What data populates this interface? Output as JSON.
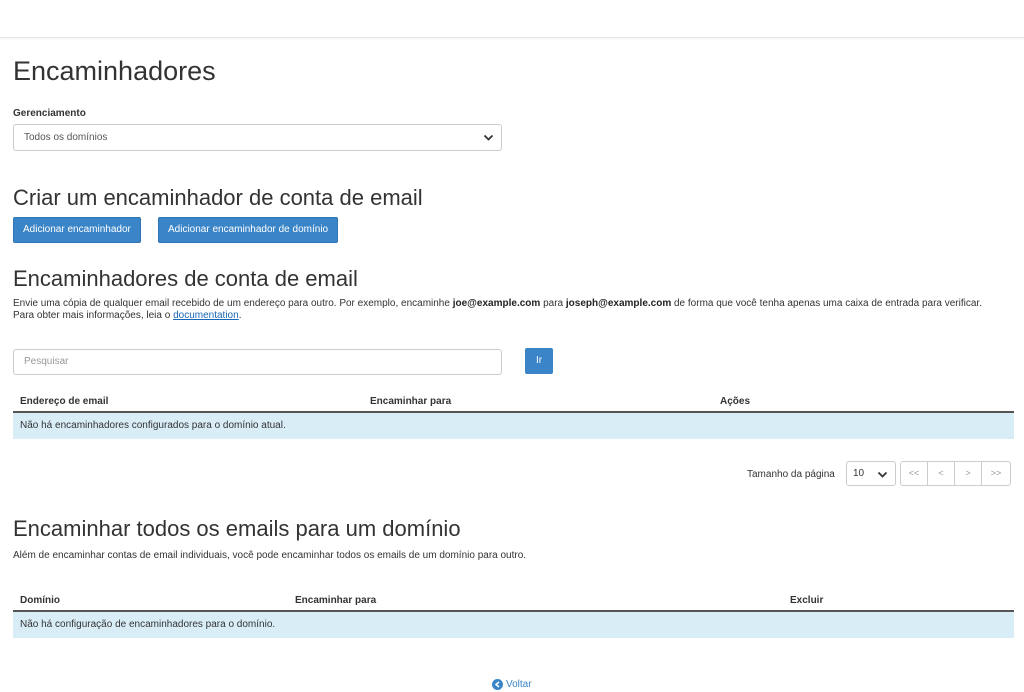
{
  "page": {
    "title": "Encaminhadores"
  },
  "management": {
    "label": "Gerenciamento",
    "selected": "Todos os domínios"
  },
  "create": {
    "heading": "Criar um encaminhador de conta de email",
    "add_forwarder": "Adicionar encaminhador",
    "add_domain_forwarder": "Adicionar encaminhador de domínio"
  },
  "account_forwarders": {
    "heading": "Encaminhadores de conta de email",
    "desc_1": "Envie uma cópia de qualquer email recebido de um endereço para outro. Por exemplo, encaminhe ",
    "desc_email1": "joe@example.com",
    "desc_2": " para ",
    "desc_email2": "joseph@example.com",
    "desc_3": " de forma que você tenha apenas uma caixa de entrada para verificar. Para obter mais informações, leia o ",
    "desc_link": "documentation",
    "desc_4": ".",
    "search_placeholder": "Pesquisar",
    "go_label": "Ir",
    "columns": [
      "Endereço de email",
      "Encaminhar para",
      "Ações"
    ],
    "empty_message": "Não há encaminhadores configurados para o domínio atual."
  },
  "pagination": {
    "page_size_label": "Tamanho da página",
    "page_size": "10",
    "first": "<<",
    "prev": "<",
    "next": ">",
    "last": ">>"
  },
  "domain_forwarders": {
    "heading": "Encaminhar todos os emails para um domínio",
    "description": "Além de encaminhar contas de email individuais, você pode encaminhar todos os emails de um domínio para outro.",
    "columns": [
      "Domínio",
      "Encaminhar para",
      "Excluir"
    ],
    "empty_message": "Não há configuração de encaminhadores para o domínio."
  },
  "footer": {
    "back_label": "Voltar"
  },
  "colors": {
    "primary": "#3a85c7",
    "info_row": "#d9edf7",
    "link": "#1a66b8"
  }
}
